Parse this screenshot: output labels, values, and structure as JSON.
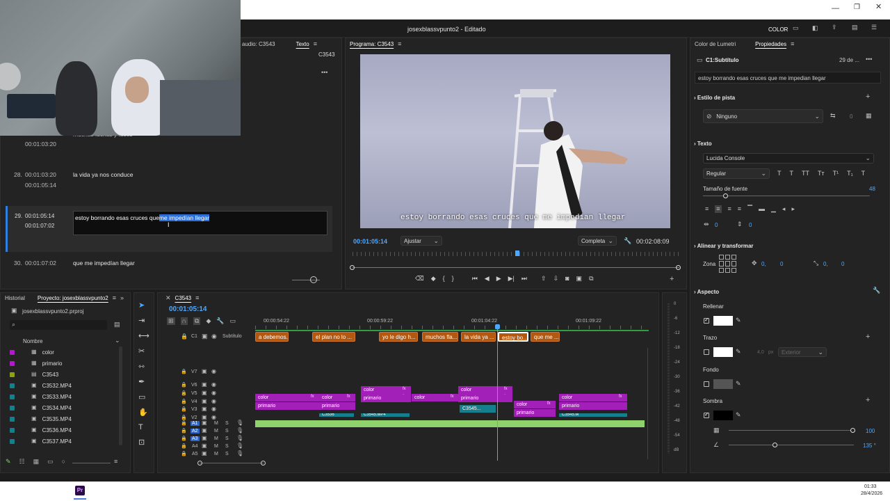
{
  "app": {
    "document_title": "josexblassvpunto2 - Editado",
    "workspace": "COLOR"
  },
  "caption_panel": {
    "tab_audio": "audio: C3543",
    "tab_text": "Texto",
    "sequence": "C3543",
    "rows": [
      {
        "num": "",
        "in": "",
        "out": "00:01:03:20",
        "text": "muchas luchas y luces"
      },
      {
        "num": "28.",
        "in": "00:01:03:20",
        "out": "00:01:05:14",
        "text": "la vida ya nos conduce"
      },
      {
        "num": "29.",
        "in": "00:01:05:14",
        "out": "00:01:07:02",
        "text_plain": "estoy borrando esas cruces que",
        "text_selected": "me impedían llegar"
      },
      {
        "num": "30.",
        "in": "00:01:07:02",
        "out": "",
        "text": "que me impedían llegar"
      }
    ]
  },
  "program_monitor": {
    "tab": "Programa: C3543",
    "subtitle": "estoy borrando esas cruces que me impedían llegar",
    "current_tc": "00:01:05:14",
    "fit_label": "Ajustar",
    "quality_label": "Completa",
    "duration_tc": "00:02:08:09"
  },
  "right_panel": {
    "tab_lumetri": "Color de Lumetri",
    "tab_props": "Propiedades",
    "clip_name": "C1:Subtítulo",
    "date": "29 de ...",
    "caption_text": "estoy borrando esas cruces que me impedian llegar",
    "track_style_title": "Estilo de pista",
    "track_style_value": "Ninguno",
    "track_style_count": "0",
    "text_title": "Texto",
    "font": "Lucida Console",
    "font_style": "Regular",
    "font_size_label": "Tamaño de fuente",
    "font_size": "48",
    "tracking_a": "0",
    "tracking_b": "0",
    "align_title": "Alinear y transformar",
    "zone_label": "Zona",
    "pos_x": "0,",
    "pos_y": "0",
    "scale_x": "0,",
    "scale_y": "0",
    "aspect_title": "Aspecto",
    "fill_label": "Rellenar",
    "stroke_label": "Trazo",
    "stroke_size": "4,0",
    "stroke_unit": "px",
    "stroke_type": "Exterior",
    "bg_label": "Fondo",
    "shadow_label": "Sombra",
    "shadow_opacity": "100",
    "shadow_angle": "135 °"
  },
  "project_panel": {
    "tab_history": "Historial",
    "tab_project": "Proyecto: josexblassvpunto2",
    "project_file": "josexblassvpunto2.prproj",
    "col_name": "Nombre",
    "items": [
      {
        "name": "color",
        "color": "#b01bc8"
      },
      {
        "name": "primario",
        "color": "#b01bc8"
      },
      {
        "name": "C3543",
        "color": "#8fa016"
      },
      {
        "name": "C3532.MP4",
        "color": "#157f8d"
      },
      {
        "name": "C3533.MP4",
        "color": "#157f8d"
      },
      {
        "name": "C3534.MP4",
        "color": "#157f8d"
      },
      {
        "name": "C3535.MP4",
        "color": "#157f8d"
      },
      {
        "name": "C3536.MP4",
        "color": "#157f8d"
      },
      {
        "name": "C3537.MP4",
        "color": "#157f8d"
      }
    ]
  },
  "timeline": {
    "tab": "C3543",
    "current_tc": "00:01:05:14",
    "ruler": [
      "00:00:54:22",
      "00:00:59:22",
      "00:01:04:22",
      "00:01:09:22"
    ],
    "caption_track": "Subtítulo",
    "caption_clips": [
      "a debemos...",
      "el plan no lo ...",
      "yo le digo h...",
      "muchos fla...",
      "la vida ya ...",
      "estoy bo...",
      "que me ..."
    ],
    "video_tracks": [
      "V7",
      "V6",
      "V5",
      "V4",
      "V3",
      "V2"
    ],
    "audio_tracks": [
      "A1",
      "A2",
      "A3",
      "A4",
      "A5"
    ],
    "c1": "C1",
    "clip_color": "color",
    "clip_primario": "primario",
    "clip_c3545": "C3545...",
    "clip_c3536": "C3536",
    "clip_c3545mp4": "C3545.MP4",
    "clip_c3545m": "C3545.M",
    "fx": "fx",
    "meter_labels": [
      "0",
      "-6",
      "-12",
      "-18",
      "-24",
      "-30",
      "-36",
      "-42",
      "-48",
      "-54",
      "dB"
    ]
  },
  "taskbar": {
    "time": "01:33",
    "date": "28/4/2026"
  },
  "colors": {
    "accent": "#4ea8ff",
    "caption_clip": "#b45810",
    "purple_clip": "#a21fb8",
    "audio_clip": "#8fd16a"
  }
}
